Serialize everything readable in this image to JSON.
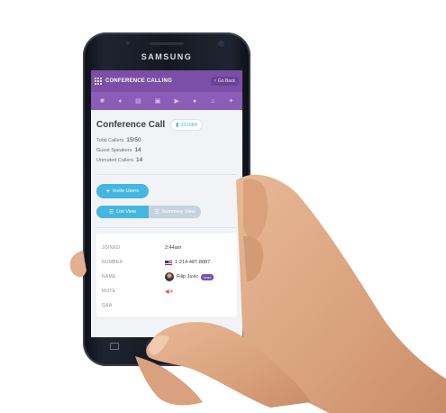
{
  "phone": {
    "brand": "SAMSUNG"
  },
  "app": {
    "title": "CONFERENCE CALLING",
    "go_back_label": "Go Back",
    "icons": [
      "settings-icon",
      "microphone-icon",
      "contacts-icon",
      "box-icon",
      "video-icon",
      "user-icon",
      "music-icon",
      "gear-icon"
    ]
  },
  "conference": {
    "title": "Conference Call",
    "room_number": "231984",
    "stats": [
      {
        "label": "Total Callers",
        "value": "15/50"
      },
      {
        "label": "Guest Speakers",
        "value": "14"
      },
      {
        "label": "Unmuted Callers",
        "value": "14"
      }
    ],
    "invite_label": "Invite Users",
    "view_toggle": {
      "list": "List View",
      "summary": "Summary View",
      "active": "list"
    }
  },
  "caller": {
    "rows": [
      {
        "key": "JOINED",
        "value": "2:44am"
      },
      {
        "key": "NUMBER",
        "value": "1-214-487-8887"
      },
      {
        "key": "NAME",
        "value": "Filip Juvic",
        "badge": "host"
      },
      {
        "key": "MUTE",
        "value": ""
      },
      {
        "key": "Q&A",
        "value": ""
      }
    ]
  },
  "colors": {
    "accent": "#45b6e0",
    "brand": "#7b4fa6"
  }
}
